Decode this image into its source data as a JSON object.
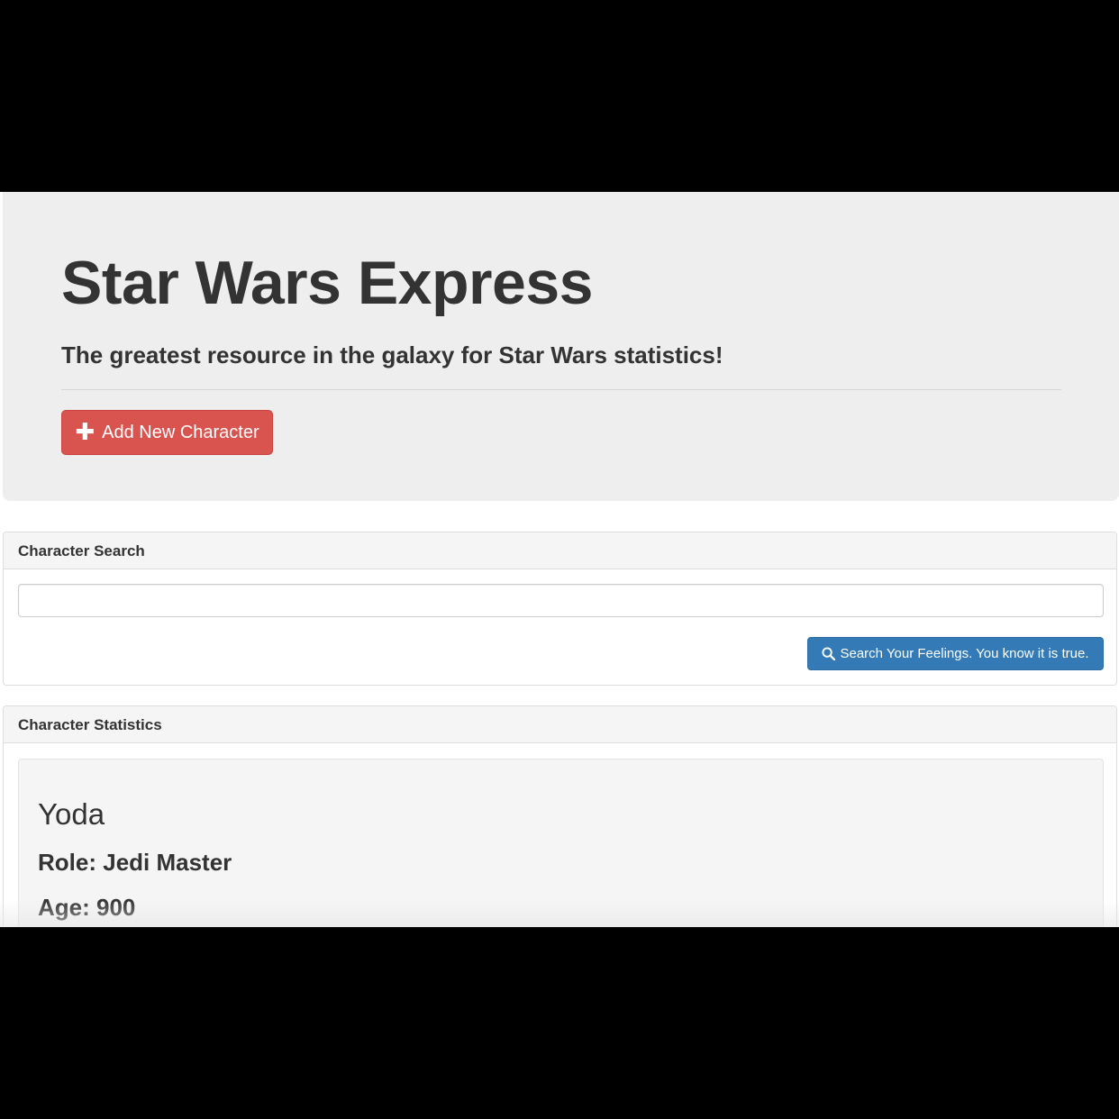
{
  "jumbotron": {
    "title": "Star Wars Express",
    "subtitle": "The greatest resource in the galaxy for Star Wars statistics!",
    "add_button_label": "Add New Character",
    "add_button_icon": "plus-icon"
  },
  "search_panel": {
    "heading": "Character Search",
    "input_value": "",
    "input_placeholder": "",
    "button_label": "Search Your Feelings. You know it is true.",
    "button_icon": "search-icon"
  },
  "stats_panel": {
    "heading": "Character Statistics",
    "character": {
      "name": "Yoda",
      "role_label": "Role:",
      "role_value": "Jedi Master",
      "age_label": "Age:",
      "age_value": "900"
    }
  },
  "colors": {
    "danger": "#d9534f",
    "primary": "#337ab7",
    "jumbotron_bg": "#eeeeee",
    "panel_heading_bg": "#f5f5f5"
  }
}
